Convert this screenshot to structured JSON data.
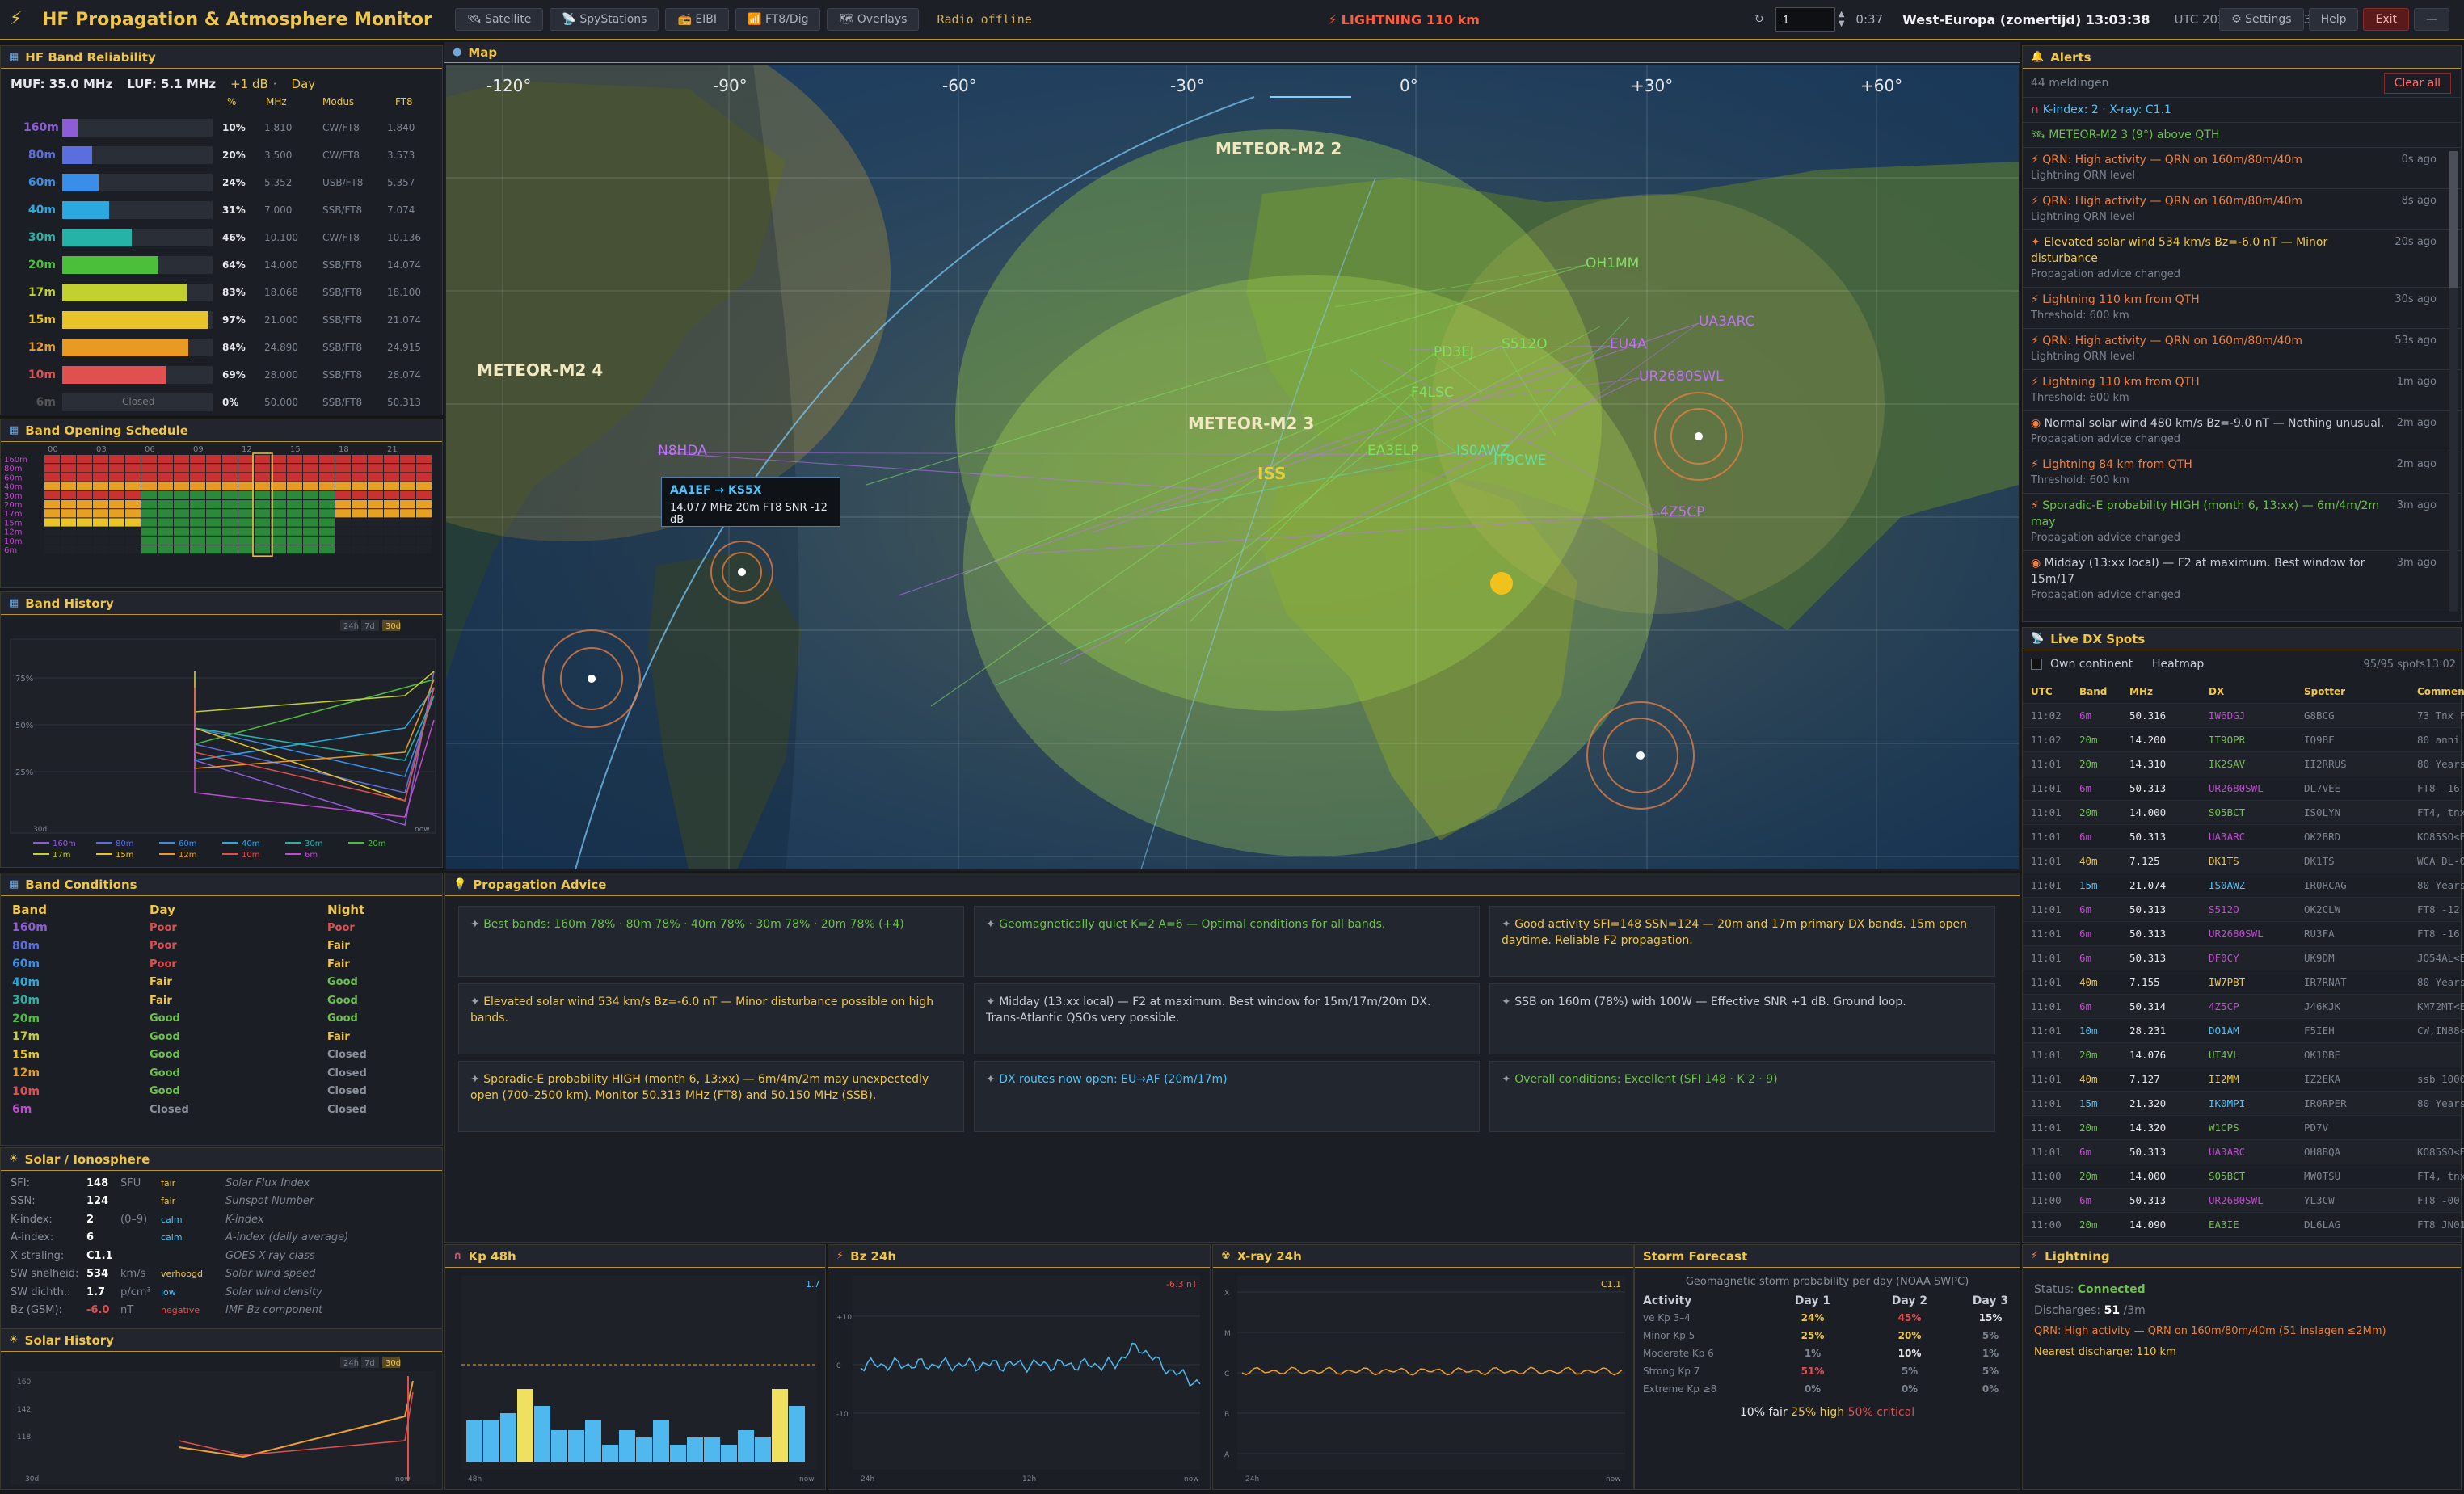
{
  "app": {
    "title": "HF Propagation & Atmosphere Monitor",
    "buttons": [
      "Satellite",
      "SpyStations",
      "EIBI",
      "FT8/Dig",
      "Overlays"
    ],
    "status": "Radio offline",
    "lightning": "LIGHTNING 110 km",
    "counter_value": "1",
    "timer": "0:37",
    "timezone": "West-Europa (zomertijd)",
    "local_time": "13:03:38",
    "utc": "UTC  2026-06-05  11:03:38",
    "right_buttons": [
      "Settings",
      "Help",
      "Exit",
      "—"
    ]
  },
  "band_reliability": {
    "title": "HF Band Reliability",
    "muf": "MUF: 35.0 MHz",
    "luf": "LUF: 5.1 MHz",
    "gain": "+1 dB",
    "day": "Day",
    "headers": [
      "%",
      "MHz",
      "Modus",
      "FT8"
    ],
    "rows": [
      {
        "band": "160m",
        "pct": "10%",
        "mhz": "1.810",
        "modus": "CW/FT8",
        "ft8": "1.840",
        "fill": 0.1,
        "color": "#8e5cd9"
      },
      {
        "band": "80m",
        "pct": "20%",
        "mhz": "3.500",
        "modus": "CW/FT8",
        "ft8": "3.573",
        "fill": 0.2,
        "color": "#5b6ee0"
      },
      {
        "band": "60m",
        "pct": "24%",
        "mhz": "5.352",
        "modus": "USB/FT8",
        "ft8": "5.357",
        "fill": 0.24,
        "color": "#3a8ee8"
      },
      {
        "band": "40m",
        "pct": "31%",
        "mhz": "7.000",
        "modus": "SSB/FT8",
        "ft8": "7.074",
        "fill": 0.31,
        "color": "#2aa8e0"
      },
      {
        "band": "30m",
        "pct": "46%",
        "mhz": "10.100",
        "modus": "CW/FT8",
        "ft8": "10.136",
        "fill": 0.46,
        "color": "#25b3a8"
      },
      {
        "band": "20m",
        "pct": "64%",
        "mhz": "14.000",
        "modus": "SSB/FT8",
        "ft8": "14.074",
        "fill": 0.64,
        "color": "#4cbf3a"
      },
      {
        "band": "17m",
        "pct": "83%",
        "mhz": "18.068",
        "modus": "SSB/FT8",
        "ft8": "18.100",
        "fill": 0.83,
        "color": "#c2d030"
      },
      {
        "band": "15m",
        "pct": "97%",
        "mhz": "21.000",
        "modus": "SSB/FT8",
        "ft8": "21.074",
        "fill": 0.97,
        "color": "#e8c42a"
      },
      {
        "band": "12m",
        "pct": "84%",
        "mhz": "24.890",
        "modus": "SSB/FT8",
        "ft8": "24.915",
        "fill": 0.84,
        "color": "#e89a22"
      },
      {
        "band": "10m",
        "pct": "69%",
        "mhz": "28.000",
        "modus": "SSB/FT8",
        "ft8": "28.074",
        "fill": 0.69,
        "color": "#e05050"
      },
      {
        "band": "6m",
        "pct": "0%",
        "mhz": "50.000",
        "modus": "SSB/FT8",
        "ft8": "50.313",
        "fill": 0,
        "color": "#555",
        "closed": "Closed"
      }
    ]
  },
  "schedule": {
    "title": "Band Opening Schedule",
    "hours": [
      "00",
      "03",
      "06",
      "09",
      "12",
      "15",
      "18",
      "21"
    ],
    "bands": [
      "160m",
      "80m",
      "60m",
      "40m",
      "30m",
      "20m",
      "17m",
      "15m",
      "12m",
      "10m",
      "6m"
    ]
  },
  "band_history": {
    "title": "Band History",
    "ranges": [
      "24h",
      "7d",
      "30d"
    ],
    "yticks": [
      "75%",
      "50%",
      "25%"
    ],
    "xstart": "30d",
    "xend": "now",
    "legend": [
      "160m",
      "80m",
      "60m",
      "40m",
      "30m",
      "20m",
      "17m",
      "15m",
      "12m",
      "10m",
      "6m"
    ]
  },
  "band_conditions": {
    "title": "Band Conditions",
    "headers": [
      "Band",
      "Day",
      "Night"
    ],
    "rows": [
      [
        "160m",
        "Poor",
        "Poor"
      ],
      [
        "80m",
        "Poor",
        "Fair"
      ],
      [
        "60m",
        "Poor",
        "Fair"
      ],
      [
        "40m",
        "Fair",
        "Good"
      ],
      [
        "30m",
        "Fair",
        "Good"
      ],
      [
        "20m",
        "Good",
        "Good"
      ],
      [
        "17m",
        "Good",
        "Fair"
      ],
      [
        "15m",
        "Good",
        "Closed"
      ],
      [
        "12m",
        "Good",
        "Closed"
      ],
      [
        "10m",
        "Good",
        "Closed"
      ],
      [
        "6m",
        "Closed",
        "Closed"
      ]
    ]
  },
  "solar": {
    "title": "Solar / Ionosphere",
    "rows": [
      [
        "SFI:",
        "148",
        "SFU",
        "fair",
        "Solar Flux Index"
      ],
      [
        "SSN:",
        "124",
        "",
        "fair",
        "Sunspot Number"
      ],
      [
        "K-index:",
        "2",
        "(0–9)",
        "calm",
        "K-index"
      ],
      [
        "A-index:",
        "6",
        "",
        "calm",
        "A-index (daily average)"
      ],
      [
        "X-straling:",
        "C1.1",
        "",
        "",
        "GOES X-ray class"
      ],
      [
        "SW snelheid:",
        "534",
        "km/s",
        "verhoogd",
        "Solar wind speed"
      ],
      [
        "SW dichth.:",
        "1.7",
        "p/cm³",
        "low",
        "Solar wind density"
      ],
      [
        "Bz (GSM):",
        "-6.0",
        "nT",
        "negative",
        "IMF Bz component"
      ]
    ]
  },
  "solar_history": {
    "title": "Solar History",
    "ranges": [
      "24h",
      "7d",
      "30d"
    ],
    "yticks": [
      "160",
      "142",
      "118"
    ],
    "xstart": "30d",
    "xend": "now"
  },
  "map": {
    "title": "Map",
    "lon_labels": [
      "-120°",
      "-90°",
      "-60°",
      "-30°",
      "0°",
      "+30°",
      "+60°"
    ],
    "sats": [
      "METEOR-M2 2",
      "METEOR-M2 4",
      "METEOR-M2 3",
      "ISS"
    ],
    "stations": [
      "OH1MM",
      "EU4A",
      "PD3EJ",
      "S512O",
      "IT9CWE",
      "4Z5CP",
      "UR2680SWL",
      "UA3ARC",
      "EA3ELP",
      "IS0AWZ",
      "F4LSC",
      "N8HDA"
    ],
    "tooltip": {
      "title": "AA1EF → KS5X",
      "line": "14.077 MHz 20m FT8 SNR -12 dB"
    }
  },
  "alerts": {
    "title": "Alerts",
    "count": "44 meldingen",
    "clear": "Clear all",
    "kx": "K-index: 2  ·  X-ray: C1.1",
    "meteor": "METEOR-M2 3 (9°) above QTH",
    "items": [
      {
        "text": "QRN: High activity — QRN on 160m/80m/40m",
        "sub": "Lightning QRN level",
        "ago": "0s ago",
        "cls": "bad"
      },
      {
        "text": "QRN: High activity — QRN on 160m/80m/40m",
        "sub": "Lightning QRN level",
        "ago": "8s ago",
        "cls": "bad"
      },
      {
        "text": "Elevated solar wind 534 km/s  Bz=-6.0 nT — Minor disturbance",
        "sub": "Propagation advice changed",
        "ago": "20s ago",
        "cls": "warn"
      },
      {
        "text": "Lightning 110 km from QTH",
        "sub": "Threshold: 600 km",
        "ago": "30s ago",
        "cls": "bad"
      },
      {
        "text": "QRN: High activity — QRN on 160m/80m/40m",
        "sub": "Lightning QRN level",
        "ago": "53s ago",
        "cls": "bad"
      },
      {
        "text": "Lightning 110 km from QTH",
        "sub": "Threshold: 600 km",
        "ago": "1m ago",
        "cls": "bad"
      },
      {
        "text": "Normal solar wind 480 km/s  Bz=-9.0 nT — Nothing unusual.",
        "sub": "Propagation advice changed",
        "ago": "2m ago",
        "cls": "plain"
      },
      {
        "text": "Lightning 84 km from QTH",
        "sub": "Threshold: 600 km",
        "ago": "2m ago",
        "cls": "bad"
      },
      {
        "text": "Sporadic-E probability HIGH (month 6, 13:xx) — 6m/4m/2m may",
        "sub": "Propagation advice changed",
        "ago": "3m ago",
        "cls": "green"
      },
      {
        "text": "Midday (13:xx local) — F2 at maximum. Best window for 15m/17",
        "sub": "Propagation advice changed",
        "ago": "3m ago",
        "cls": "plain"
      }
    ]
  },
  "dx": {
    "title": "Live DX Spots",
    "own": "Own continent",
    "heatmap": "Heatmap",
    "count": "95/95 spots",
    "time": "13:02",
    "headers": [
      "UTC",
      "Band",
      "MHz",
      "DX",
      "Spotter",
      "Comment"
    ],
    "rows": [
      [
        "11:02",
        "6m",
        "50.316",
        "IW6DGJ",
        "G8BCG",
        "73 Tnx FT8"
      ],
      [
        "11:02",
        "20m",
        "14.200",
        "IT9OPR",
        "IQ9BF",
        "80 anni ..."
      ],
      [
        "11:01",
        "20m",
        "14.310",
        "IK2SAV",
        "II2RRUS",
        "80 Years Italian ..."
      ],
      [
        "11:01",
        "6m",
        "50.313",
        "UR2680SWL",
        "DL7VEE",
        "FT8 -16 CQ"
      ],
      [
        "11:01",
        "20m",
        "14.000",
        "S05BCT",
        "IS0LYN",
        "FT4, tnx 73"
      ],
      [
        "11:01",
        "6m",
        "50.313",
        "UA3ARC",
        "OK2BRD",
        "KO85SO<ES>JN99 FT..."
      ],
      [
        "11:01",
        "40m",
        "7.125",
        "DK1TS",
        "DK1TS",
        "WCA DL-02086"
      ],
      [
        "11:01",
        "15m",
        "21.074",
        "IS0AWZ",
        "IR0RCAG",
        "80 Years Italian ..."
      ],
      [
        "11:01",
        "6m",
        "50.313",
        "S512O",
        "OK2CLW",
        "FT8 -12 dB 1260 Hz"
      ],
      [
        "11:01",
        "6m",
        "50.313",
        "UR2680SWL",
        "RU3FA",
        "FT8 -16 CQ"
      ],
      [
        "11:01",
        "6m",
        "50.313",
        "DF0CY",
        "UK9DM",
        "JO54AL<ES>KO96 FT..."
      ],
      [
        "11:01",
        "40m",
        "7.155",
        "IW7PBT",
        "IR7RNAT",
        "80 Years Italian ..."
      ],
      [
        "11:01",
        "6m",
        "50.314",
        "4Z5CP",
        "J46KJK",
        "KM72MT<ES>PM53FH"
      ],
      [
        "11:01",
        "10m",
        "28.231",
        "DO1AM",
        "F5IEH",
        "CW,IN88<ES>JO51,5..."
      ],
      [
        "11:01",
        "20m",
        "14.076",
        "UT4VL",
        "OK1DBE",
        ""
      ],
      [
        "11:01",
        "40m",
        "7.127",
        "II2MM",
        "IZ2EKA",
        "ssb 1000 Miglia"
      ],
      [
        "11:01",
        "15m",
        "21.320",
        "IK0MPI",
        "IR0RPER",
        "80 Years Italian ..."
      ],
      [
        "11:01",
        "20m",
        "14.320",
        "W1CPS",
        "PD7V",
        ""
      ],
      [
        "11:01",
        "6m",
        "50.313",
        "UA3ARC",
        "OH8BQA",
        "KO85SO<ES>JO73 FT..."
      ],
      [
        "11:00",
        "20m",
        "14.000",
        "S05BCT",
        "MW0TSU",
        "FT4, tnx 73"
      ],
      [
        "11:00",
        "6m",
        "50.313",
        "UR2680SWL",
        "YL3CW",
        "FT8 -00"
      ],
      [
        "11:00",
        "20m",
        "14.090",
        "EA3IE",
        "DL6LAG",
        "FT8 JN01sf -> JO51"
      ]
    ]
  },
  "advice": {
    "title": "Propagation Advice",
    "cards": [
      {
        "text": "Best bands: 160m 78%  ·  80m 78%  ·  40m 78%  ·  30m 78%  ·  20m 78%  (+4)",
        "cls": "green"
      },
      {
        "text": "Geomagnetically quiet K=2 A=6 — Optimal conditions for all bands.",
        "cls": "green"
      },
      {
        "text": "Good activity SFI=148 SSN=124 — 20m and 17m primary DX bands. 15m open daytime. Reliable F2 propagation.",
        "cls": "warn"
      },
      {
        "text": "Elevated solar wind 534 km/s  Bz=-6.0 nT — Minor disturbance possible on high bands.",
        "cls": "warn"
      },
      {
        "text": "Midday (13:xx local) — F2 at maximum. Best window for 15m/17m/20m DX. Trans-Atlantic QSOs very possible.",
        "cls": "plain"
      },
      {
        "text": "SSB on 160m (78%) with 100W — Effective SNR +1 dB. Ground loop.",
        "cls": "plain"
      },
      {
        "text": "Sporadic-E probability HIGH (month 6, 13:xx) — 6m/4m/2m may unexpectedly open (700–2500 km). Monitor 50.313 MHz (FT8) and 50.150 MHz (SSB).",
        "cls": "warn"
      },
      {
        "text": "DX routes now open: EU→AF (20m/17m)",
        "cls": "blue"
      },
      {
        "text": "Overall conditions: Excellent  (SFI 148 · K 2 · 9)",
        "cls": "green"
      }
    ]
  },
  "kp": {
    "title": "Kp 48h",
    "last": "1.7",
    "xstart": "48h",
    "xend": "now",
    "values": [
      1.7,
      1.7,
      2.0,
      3.0,
      2.3,
      1.3,
      1.3,
      1.7,
      0.7,
      1.3,
      1.0,
      1.7,
      0.7,
      1.0,
      1.0,
      0.7,
      1.3,
      1.0,
      3.0,
      2.3
    ]
  },
  "bz": {
    "title": "Bz 24h",
    "last": "-6.3 nT",
    "yticks": [
      "+10",
      "0",
      "-10"
    ],
    "xstart": "24h",
    "xmid": "12h",
    "xend": "now"
  },
  "xray": {
    "title": "X-ray 24h",
    "last": "C1.1",
    "yticks": [
      "X",
      "M",
      "C",
      "B",
      "A"
    ],
    "xstart": "24h",
    "xend": "now"
  },
  "storm": {
    "title": "Storm Forecast",
    "subtitle": "Geomagnetic storm probability per day (NOAA SWPC)",
    "headers": [
      "Activity",
      "Day 1",
      "Day 2",
      "Day 3"
    ],
    "rows": [
      [
        "ve Kp 3–4",
        "24%",
        "45%",
        "15%"
      ],
      [
        "Minor Kp 5",
        "25%",
        "20%",
        "5%"
      ],
      [
        "Moderate Kp 6",
        "1%",
        "10%",
        "1%"
      ],
      [
        "Strong Kp 7",
        "51%",
        "5%",
        "5%"
      ],
      [
        "Extreme Kp ≥8",
        "0%",
        "0%",
        "0%"
      ]
    ],
    "summary": [
      "10% fair",
      "25% high",
      "50% critical"
    ]
  },
  "lightning": {
    "title": "Lightning",
    "status_label": "Status:",
    "status": "Connected",
    "discharges_label": "Discharges:",
    "discharges": "51",
    "per": "/3m",
    "qrn": "QRN: High activity — QRN on 160m/80m/40m (51 inslagen ≤2Mm)",
    "nearest": "Nearest discharge: 110 km"
  }
}
